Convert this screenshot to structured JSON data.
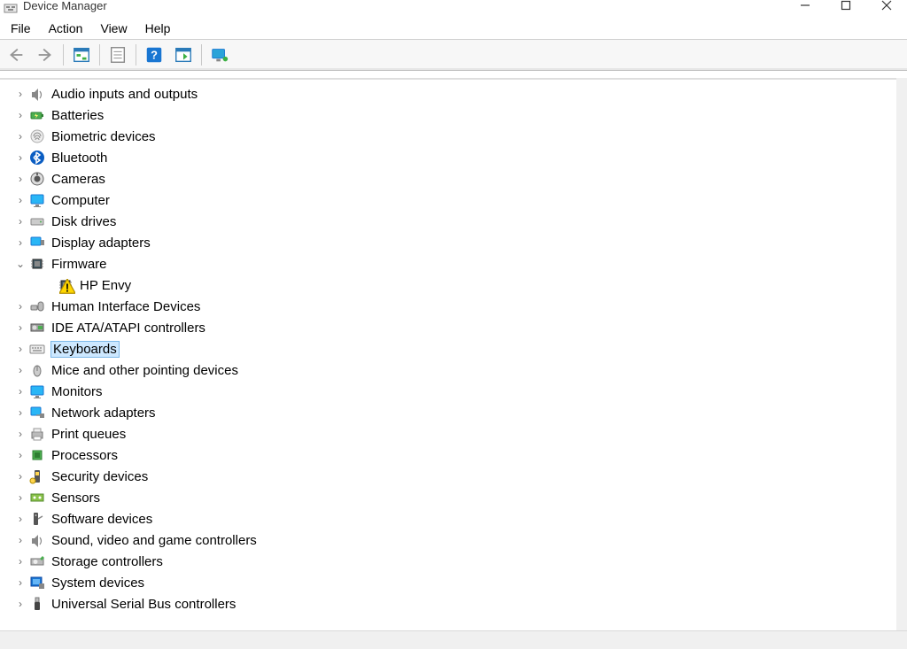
{
  "window": {
    "title": "Device Manager"
  },
  "menu": {
    "file": "File",
    "action": "Action",
    "view": "View",
    "help": "Help"
  },
  "tree": {
    "items": [
      {
        "name": "audio-devices",
        "label": "Audio inputs and outputs",
        "icon": "speaker-icon",
        "expanded": false,
        "selected": false,
        "children": []
      },
      {
        "name": "batteries",
        "label": "Batteries",
        "icon": "battery-icon",
        "expanded": false,
        "selected": false,
        "children": []
      },
      {
        "name": "biometric-devices",
        "label": "Biometric devices",
        "icon": "fingerprint-icon",
        "expanded": false,
        "selected": false,
        "children": []
      },
      {
        "name": "bluetooth",
        "label": "Bluetooth",
        "icon": "bluetooth-icon",
        "expanded": false,
        "selected": false,
        "children": []
      },
      {
        "name": "cameras",
        "label": "Cameras",
        "icon": "camera-icon",
        "expanded": false,
        "selected": false,
        "children": []
      },
      {
        "name": "computer",
        "label": "Computer",
        "icon": "monitor-icon",
        "expanded": false,
        "selected": false,
        "children": []
      },
      {
        "name": "disk-drives",
        "label": "Disk drives",
        "icon": "disk-icon",
        "expanded": false,
        "selected": false,
        "children": []
      },
      {
        "name": "display-adapters",
        "label": "Display adapters",
        "icon": "display-adapter-icon",
        "expanded": false,
        "selected": false,
        "children": []
      },
      {
        "name": "firmware",
        "label": "Firmware",
        "icon": "chip-icon",
        "expanded": true,
        "selected": false,
        "children": [
          {
            "name": "firmware-hp-envy",
            "label": "HP Envy",
            "icon": "chip-icon",
            "warning": true
          }
        ]
      },
      {
        "name": "hid",
        "label": "Human Interface Devices",
        "icon": "hid-icon",
        "expanded": false,
        "selected": false,
        "children": []
      },
      {
        "name": "ide-controllers",
        "label": "IDE ATA/ATAPI controllers",
        "icon": "ide-icon",
        "expanded": false,
        "selected": false,
        "children": []
      },
      {
        "name": "keyboards",
        "label": "Keyboards",
        "icon": "keyboard-icon",
        "expanded": false,
        "selected": true,
        "children": []
      },
      {
        "name": "mice",
        "label": "Mice and other pointing devices",
        "icon": "mouse-icon",
        "expanded": false,
        "selected": false,
        "children": []
      },
      {
        "name": "monitors",
        "label": "Monitors",
        "icon": "monitor-icon",
        "expanded": false,
        "selected": false,
        "children": []
      },
      {
        "name": "network-adapters",
        "label": "Network adapters",
        "icon": "network-icon",
        "expanded": false,
        "selected": false,
        "children": []
      },
      {
        "name": "print-queues",
        "label": "Print queues",
        "icon": "printer-icon",
        "expanded": false,
        "selected": false,
        "children": []
      },
      {
        "name": "processors",
        "label": "Processors",
        "icon": "cpu-icon",
        "expanded": false,
        "selected": false,
        "children": []
      },
      {
        "name": "security-devices",
        "label": "Security devices",
        "icon": "security-icon",
        "expanded": false,
        "selected": false,
        "children": []
      },
      {
        "name": "sensors",
        "label": "Sensors",
        "icon": "sensor-icon",
        "expanded": false,
        "selected": false,
        "children": []
      },
      {
        "name": "software-devices",
        "label": "Software devices",
        "icon": "software-icon",
        "expanded": false,
        "selected": false,
        "children": []
      },
      {
        "name": "sound-video-game",
        "label": "Sound, video and game controllers",
        "icon": "speaker-icon",
        "expanded": false,
        "selected": false,
        "children": []
      },
      {
        "name": "storage-controllers",
        "label": "Storage controllers",
        "icon": "storage-icon",
        "expanded": false,
        "selected": false,
        "children": []
      },
      {
        "name": "system-devices",
        "label": "System devices",
        "icon": "system-icon",
        "expanded": false,
        "selected": false,
        "children": []
      },
      {
        "name": "usb-controllers",
        "label": "Universal Serial Bus controllers",
        "icon": "usb-icon",
        "expanded": false,
        "selected": false,
        "children": []
      }
    ]
  }
}
